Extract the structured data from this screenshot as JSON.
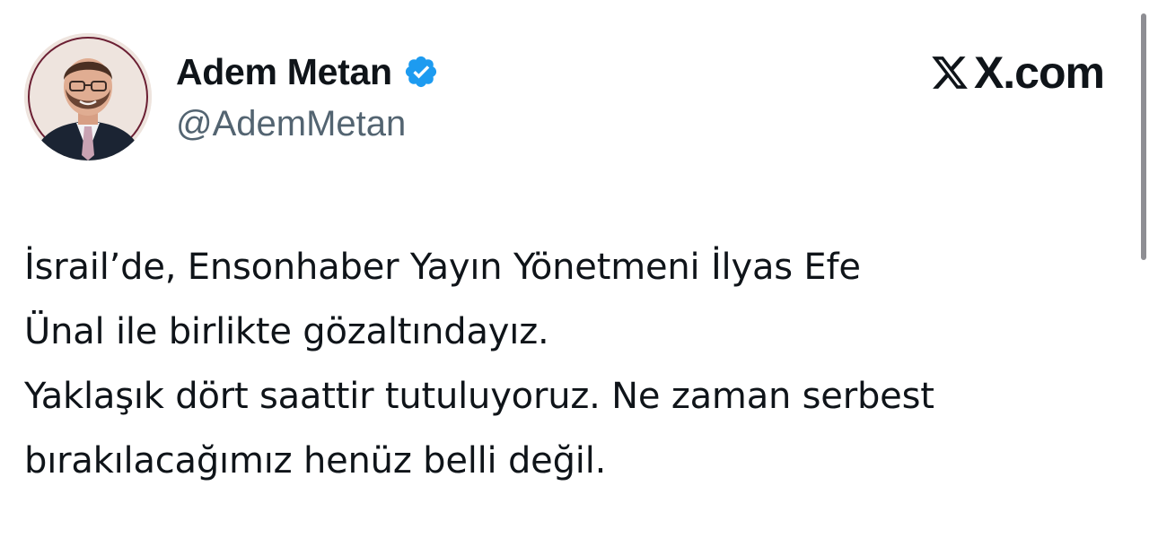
{
  "author": {
    "display_name": "Adem Metan",
    "handle": "@AdemMetan",
    "verified": true,
    "avatar": "profile-photo"
  },
  "brand": {
    "text": "X.com",
    "logo": "x-logo-icon"
  },
  "tweet": {
    "lines": [
      "İsrail’de, Ensonhaber Yayın Yönetmeni İlyas Efe",
      "Ünal ile birlikte gözaltındayız.",
      "Yaklaşık dört saattir tutuluyoruz. Ne zaman serbest",
      "bırakılacağımız henüz belli değil."
    ]
  },
  "colors": {
    "text": "#0f1419",
    "secondary_text": "#536471",
    "verified_badge": "#1d9bf0",
    "background": "#ffffff"
  }
}
